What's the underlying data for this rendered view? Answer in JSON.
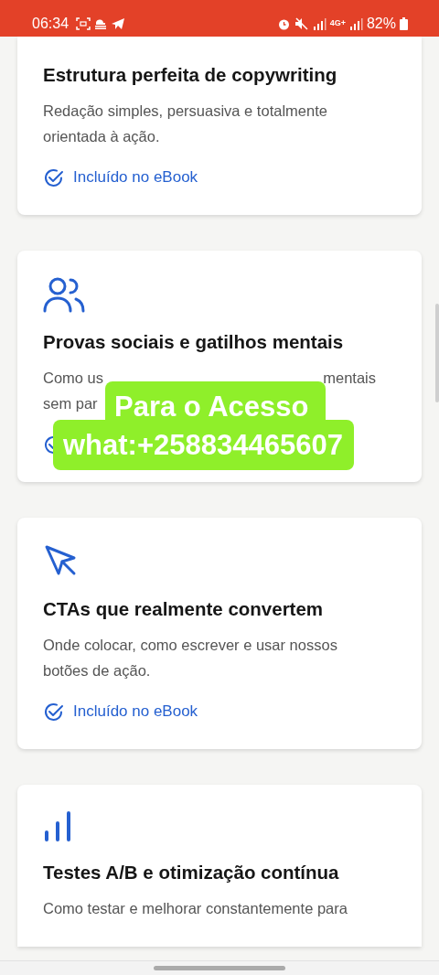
{
  "status_bar": {
    "time": "06:34",
    "network": "4G+",
    "battery": "82%"
  },
  "cards": [
    {
      "title": "Estrutura perfeita de copywriting",
      "description": "Redação simples, persuasiva e totalmente orientada à ação.",
      "included_mark": true,
      "included_label": "Incluído no eBook"
    },
    {
      "title": "Provas sociais e gatilhos mentais",
      "description_fragments": [
        [
          "Como us",
          "mentais"
        ],
        [
          "sem par"
        ]
      ],
      "included_mark": true
    },
    {
      "title": "CTAs que realmente convertem",
      "description": "Onde colocar, como escrever e usar nossos botões de ação.",
      "included_mark": true,
      "included_label": "Incluído no eBook"
    },
    {
      "title": "Testes A/B e otimização contínua",
      "description": "Como testar e melhorar constantemente para"
    }
  ],
  "overlay": {
    "lines": [
      "Para o Acesso",
      "what:+258834465607"
    ]
  }
}
